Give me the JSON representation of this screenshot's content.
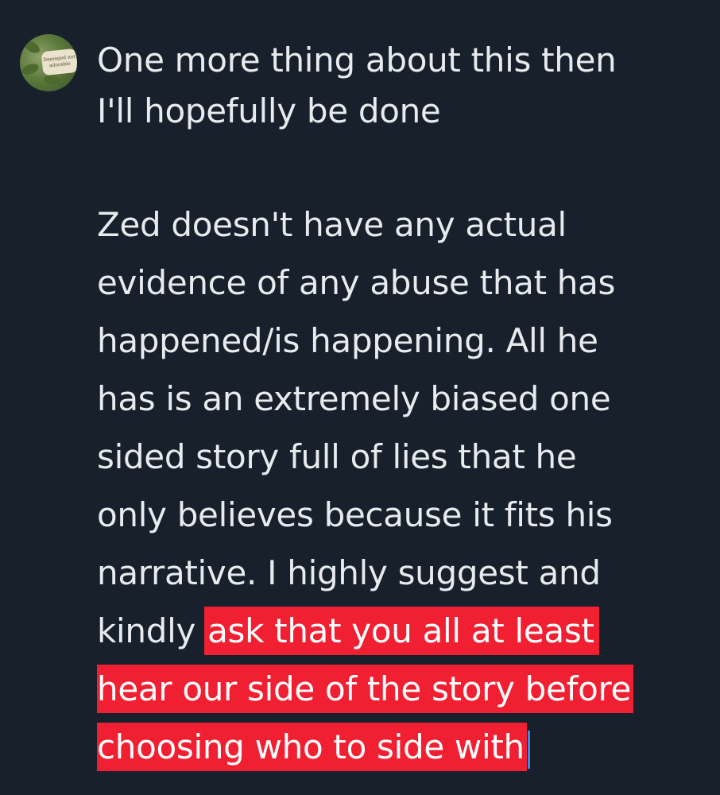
{
  "post": {
    "avatar_text": "Damaged not adorable",
    "lines_plain": [
      "One more thing about this then",
      "I'll hopefully be done",
      "Zed doesn't have any actual",
      "evidence of any abuse that has",
      "happened/is happening. All he",
      "has is an extremely biased one",
      "sided story full of lies that he",
      "only believes because it fits his",
      "narrative. I highly suggest and"
    ],
    "line_kindly_plain": "kindly",
    "line_kindly_highlight": "ask that you all at least",
    "highlight_line_2": "hear our side of the story before",
    "highlight_line_3": "choosing who to side with",
    "highlight_color": "#f02032",
    "background_color": "#17202b",
    "text_color": "#e8ebee"
  }
}
